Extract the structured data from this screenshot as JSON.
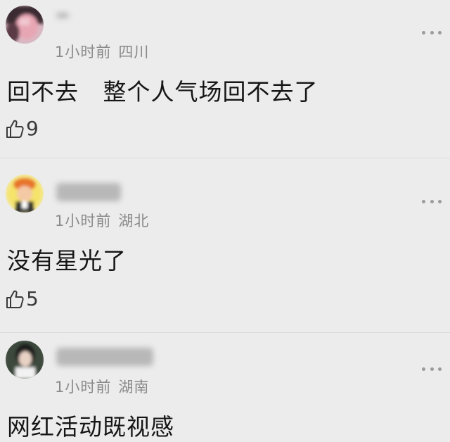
{
  "comments": [
    {
      "time": "1小时前",
      "location": "四川",
      "text": "回不去   整个人气场回不去了",
      "likes": "9"
    },
    {
      "time": "1小时前",
      "location": "湖北",
      "text": "没有星光了",
      "likes": "5"
    },
    {
      "time": "1小时前",
      "location": "湖南",
      "text": "网红活动既视感",
      "likes": ""
    }
  ],
  "icons": {
    "like": "thumbs-up-outline-icon",
    "more": "more-dots-icon"
  },
  "colors": {
    "background": "#ececec",
    "meta_text": "#8a8a8a",
    "body_text": "#161616"
  }
}
